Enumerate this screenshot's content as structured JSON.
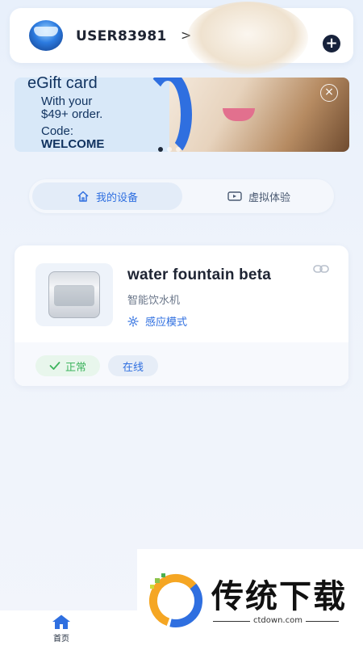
{
  "header": {
    "username": "USER83981",
    "chevron": ">",
    "add_icon": "+",
    "notification_dot_color": "#ff5a36"
  },
  "banner": {
    "title": "eGift card",
    "line1": "With your",
    "line2": "$49+ order.",
    "line3": "Code:",
    "code": "WELCOME",
    "close": "×",
    "slides": 3,
    "active_slide": 0
  },
  "tabs": [
    {
      "label": "我的设备",
      "icon": "home-icon",
      "active": true
    },
    {
      "label": "虚拟体验",
      "icon": "video-icon",
      "active": false
    }
  ],
  "device": {
    "name": "water fountain beta",
    "type": "智能饮水机",
    "mode": "感应模式",
    "status": "正常",
    "connection": "在线"
  },
  "bottom_nav": {
    "home_label": "首页"
  },
  "watermark": {
    "text": "传统下载",
    "url": "ctdown.com"
  },
  "colors": {
    "accent": "#2f6fe0",
    "ok": "#3eb45e",
    "dark": "#17223b"
  }
}
